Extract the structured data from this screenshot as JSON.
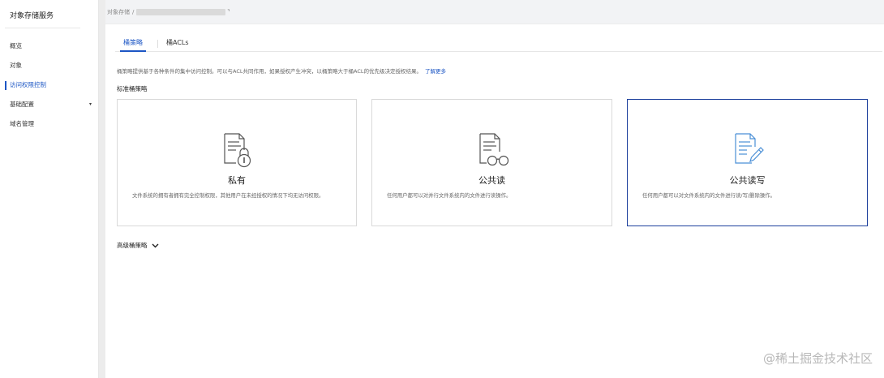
{
  "sidebar": {
    "title": "对象存储服务",
    "items": [
      {
        "label": "概览"
      },
      {
        "label": "对象"
      },
      {
        "label": "访问权限控制"
      },
      {
        "label": "基础配置"
      },
      {
        "label": "域名管理"
      }
    ],
    "active_index": 2,
    "expand_arrow": "▾"
  },
  "breadcrumb": {
    "root": "对象存储",
    "separator": "/",
    "ext_icon": "⌝"
  },
  "tabs": [
    {
      "label": "桶策略"
    },
    {
      "label": "桶ACLs"
    }
  ],
  "description": {
    "text": "桶策略提供基于各种条件的集中访问控制。可以与ACL共同作用，如果授权产生冲突，以桶策略大于桶ACL的优先级决定授权结果。",
    "link": "了解更多"
  },
  "standard_policy": {
    "title": "标准桶策略",
    "cards": [
      {
        "title": "私有",
        "desc": "文件系统的拥有者拥有完全控制权限，其他用户在未经授权的情况下均无访问权限。",
        "icon": "document-lock-icon",
        "selected": false
      },
      {
        "title": "公共读",
        "desc": "任何用户都可以对并行文件系统内的文件进行读操作。",
        "icon": "document-glasses-icon",
        "selected": false
      },
      {
        "title": "公共读写",
        "desc": "任何用户都可以对文件系统内的文件进行读/写/删除操作。",
        "icon": "document-pencil-icon",
        "selected": true
      }
    ]
  },
  "advanced_policy": {
    "label": "高级桶策略"
  },
  "watermark": "@稀土掘金技术社区",
  "colors": {
    "accent": "#1c56c4",
    "selected_border": "#1c3f9c",
    "icon_gray": "#555555",
    "icon_blue": "#4a8fd6"
  }
}
